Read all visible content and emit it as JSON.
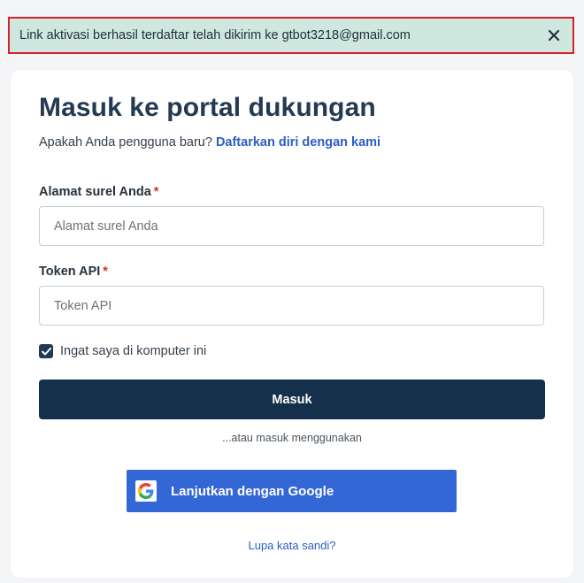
{
  "alert": {
    "message": "Link aktivasi berhasil terdaftar telah dikirim ke gtbot3218@gmail.com",
    "close_icon": "close-icon"
  },
  "login": {
    "title": "Masuk ke portal dukungan",
    "new_user_text": "Apakah Anda pengguna baru?",
    "signup_link": "Daftarkan diri dengan kami",
    "email": {
      "label": "Alamat surel Anda",
      "required_mark": "*",
      "placeholder": "Alamat surel Anda",
      "value": ""
    },
    "token": {
      "label": "Token API",
      "required_mark": "*",
      "placeholder": "Token API",
      "value": ""
    },
    "remember": {
      "label": "Ingat saya di komputer ini",
      "checked": true
    },
    "submit_label": "Masuk",
    "or_text": "...atau masuk menggunakan",
    "google_label": "Lanjutkan dengan Google",
    "forgot_label": "Lupa kata sandi?"
  },
  "colors": {
    "alert_bg": "#cfe8df",
    "alert_border": "#d9212b",
    "primary_button": "#14304a",
    "google_button": "#3467d6",
    "link": "#2c5cc5",
    "required": "#d0312d"
  }
}
